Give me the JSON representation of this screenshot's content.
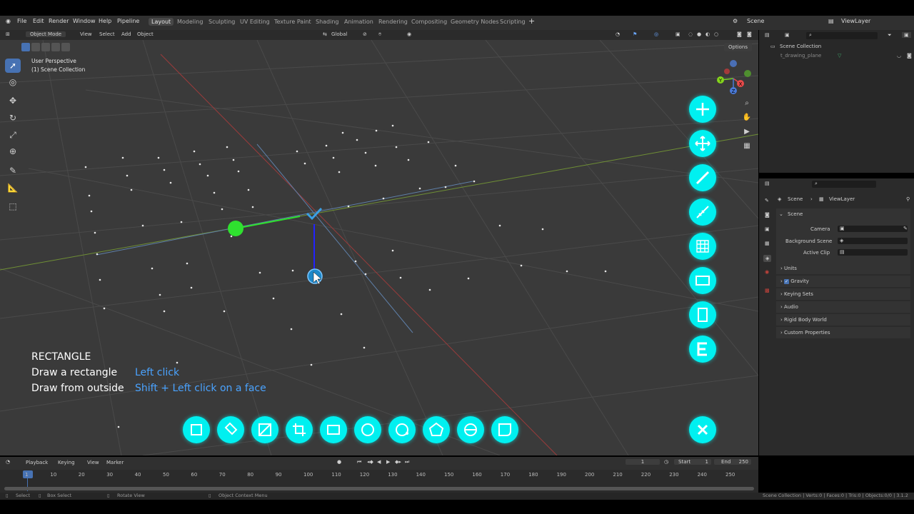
{
  "topbar": {
    "menus": [
      "File",
      "Edit",
      "Render",
      "Window",
      "Help",
      "Pipeline"
    ],
    "workspaces": [
      "Layout",
      "Modeling",
      "Sculpting",
      "UV Editing",
      "Texture Paint",
      "Shading",
      "Animation",
      "Rendering",
      "Compositing",
      "Geometry Nodes",
      "Scripting"
    ],
    "active_workspace": "Layout",
    "scene": "Scene",
    "view_layer": "ViewLayer"
  },
  "viewport_header": {
    "mode": "Object Mode",
    "menus": [
      "View",
      "Select",
      "Add",
      "Object"
    ],
    "orientation": "Global",
    "options": "Options"
  },
  "viewport": {
    "perspective": "User Perspective",
    "collection": "(1) Scene Collection",
    "axis_x": "X",
    "axis_y": "Y",
    "axis_z": "Z"
  },
  "help": {
    "title": "RECTANGLE",
    "line1_label": "Draw a rectangle",
    "line1_action": "Left click",
    "line2_label": "Draw from outside",
    "line2_action": "Shift + Left click on a face"
  },
  "outliner": {
    "root": "Scene Collection",
    "item": "t_drawing_plane"
  },
  "properties": {
    "breadcrumb_scene": "Scene",
    "breadcrumb_layer": "ViewLayer",
    "section": "Scene",
    "camera_label": "Camera",
    "background_label": "Background Scene",
    "clip_label": "Active Clip",
    "sections": [
      "Units",
      "Gravity",
      "Keying Sets",
      "Audio",
      "Rigid Body World",
      "Custom Properties"
    ]
  },
  "timeline": {
    "menus": [
      "Playback",
      "Keying",
      "View",
      "Marker"
    ],
    "current_frame": "1",
    "start_label": "Start",
    "start": "1",
    "end_label": "End",
    "end": "250",
    "ticks": [
      "1",
      "10",
      "20",
      "30",
      "40",
      "50",
      "60",
      "70",
      "80",
      "90",
      "100",
      "110",
      "120",
      "130",
      "140",
      "150",
      "160",
      "170",
      "180",
      "190",
      "200",
      "210",
      "220",
      "230",
      "240",
      "250"
    ]
  },
  "statusbar": {
    "select": "Select",
    "box_select": "Box Select",
    "rotate": "Rotate View",
    "context": "Object Context Menu",
    "stats": "Scene Collection | Verts:0 | Faces:0 | Tris:0 | Objects:0/0 | 3.1.2"
  },
  "colors": {
    "accent": "#00f0f0",
    "active_blue": "#4772b3",
    "help_blue": "#4aa3ff"
  }
}
